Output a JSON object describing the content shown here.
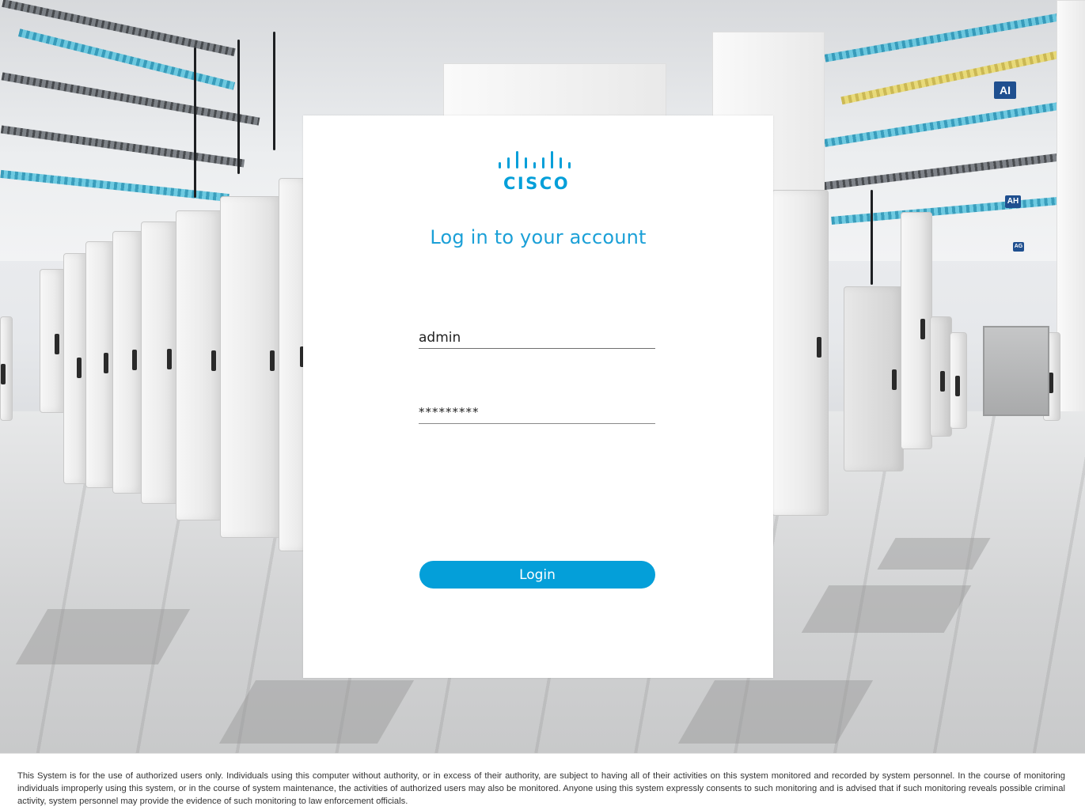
{
  "brand": {
    "name": "cisco",
    "logo_text": "CISCO",
    "color": "#049fd9"
  },
  "login": {
    "title": "Log in to your account",
    "username_value": "admin",
    "password_value": "*********",
    "submit_label": "Login"
  },
  "background": {
    "signs": [
      "AI",
      "AH",
      "AG"
    ]
  },
  "footer": {
    "disclaimer": "This System is for the use of authorized users only. Individuals using this computer without authority, or in excess of their authority, are subject to having all of their activities on this system monitored and recorded by system personnel. In the course of monitoring individuals improperly using this system, or in the course of system maintenance, the activities of authorized users may also be monitored. Anyone using this system expressly consents to such monitoring and is advised that if such monitoring reveals possible criminal activity, system personnel may provide the evidence of such monitoring to law enforcement officials."
  }
}
